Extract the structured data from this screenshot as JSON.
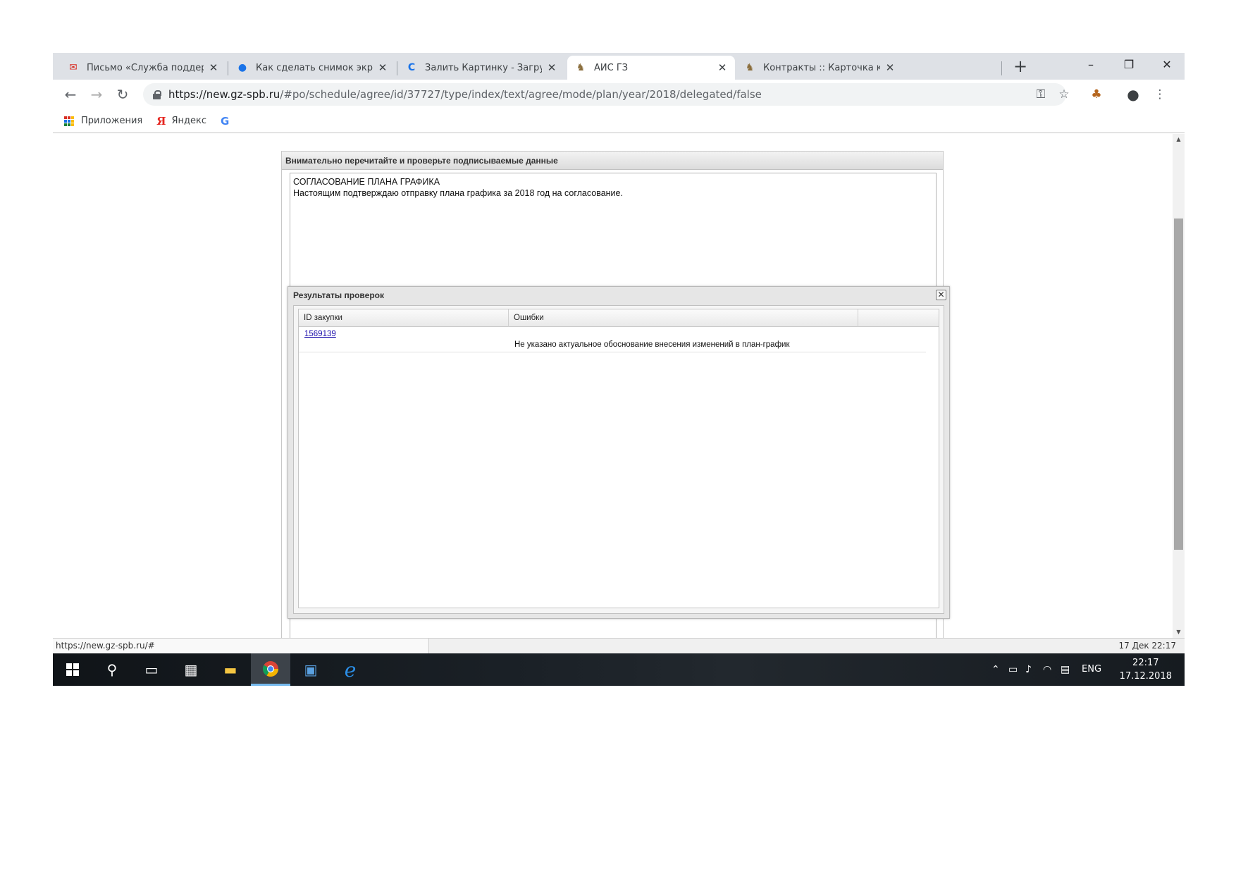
{
  "tabs": [
    {
      "title": "Письмо «Служба поддержки",
      "icon": "mail-icon",
      "active": false
    },
    {
      "title": "Как сделать снимок экрана (с",
      "icon": "globe-icon",
      "active": false
    },
    {
      "title": "Залить Картинку - Загрузить с",
      "icon": "loading-icon",
      "active": false
    },
    {
      "title": "АИС ГЗ",
      "icon": "crest-icon",
      "active": true
    },
    {
      "title": "Контракты :: Карточка контра",
      "icon": "crest-icon",
      "active": false
    }
  ],
  "window": {
    "minimize": "–",
    "restore": "❐",
    "close": "✕"
  },
  "toolbar": {
    "url_host": "https://new.gz-spb.ru",
    "url_path": "/#po/schedule/agree/id/37727/type/index/text/agree/mode/plan/year/2018/delegated/false"
  },
  "bookmarks": [
    {
      "label": "Приложения",
      "icon": "apps-grid-icon"
    },
    {
      "label": "Яндекс",
      "icon": "yandex-icon"
    },
    {
      "label": "",
      "icon": "google-icon"
    }
  ],
  "sign_panel": {
    "header": "Внимательно перечитайте и проверьте подписываемые данные",
    "line1": "СОГЛАСОВАНИЕ ПЛАНА ГРАФИКА",
    "line2": "Настоящим подтверждаю отправку плана графика за 2018 год на согласование."
  },
  "results_dialog": {
    "title": "Результаты проверок",
    "columns": [
      "ID закупки",
      "Ошибки"
    ],
    "rows": [
      {
        "id": "1569139",
        "error": "Не указано актуальное обоснование внесения изменений в план-график"
      }
    ]
  },
  "statusbar": {
    "url": "https://new.gz-spb.ru/#",
    "datetime": "17 Дек 22:17"
  },
  "taskbar": {
    "lang": "ENG",
    "time": "22:17",
    "date": "17.12.2018"
  },
  "colors": {
    "tab_strip": "#dee1e6",
    "link": "#1a0dab",
    "taskbar_active_underline": "#76b9ed"
  }
}
